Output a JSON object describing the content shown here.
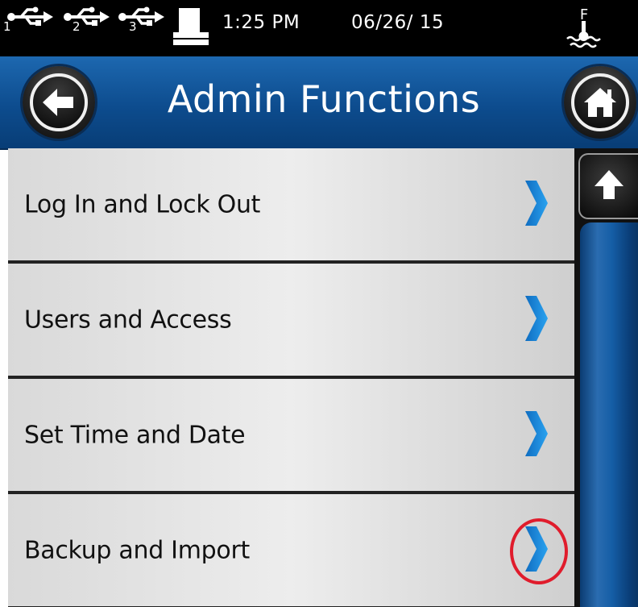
{
  "status_bar": {
    "usb_ports": [
      {
        "label": "1",
        "icon": "usb-icon"
      },
      {
        "label": "2",
        "icon": "usb-icon"
      },
      {
        "label": "3",
        "icon": "usb-icon"
      }
    ],
    "printer_icon": "printer-icon",
    "time": "1:25 PM",
    "date": "06/26/ 15",
    "water_icon": "water-level-icon",
    "water_label": "F"
  },
  "header": {
    "title": "Admin Functions",
    "back_icon": "back-arrow-icon",
    "home_icon": "home-icon",
    "color": "#0d4c8e"
  },
  "menu": {
    "items": [
      {
        "label": "Log In and Lock Out",
        "icon": "chevron-right-icon"
      },
      {
        "label": "Users and Access",
        "icon": "chevron-right-icon"
      },
      {
        "label": "Set Time and Date",
        "icon": "chevron-right-icon"
      },
      {
        "label": "Backup and Import",
        "icon": "chevron-right-icon",
        "highlighted": true
      }
    ],
    "highlight_color": "#e01c2c",
    "chevron_color": "#1a8ee6"
  },
  "scrollbar": {
    "up_icon": "arrow-up-icon"
  }
}
